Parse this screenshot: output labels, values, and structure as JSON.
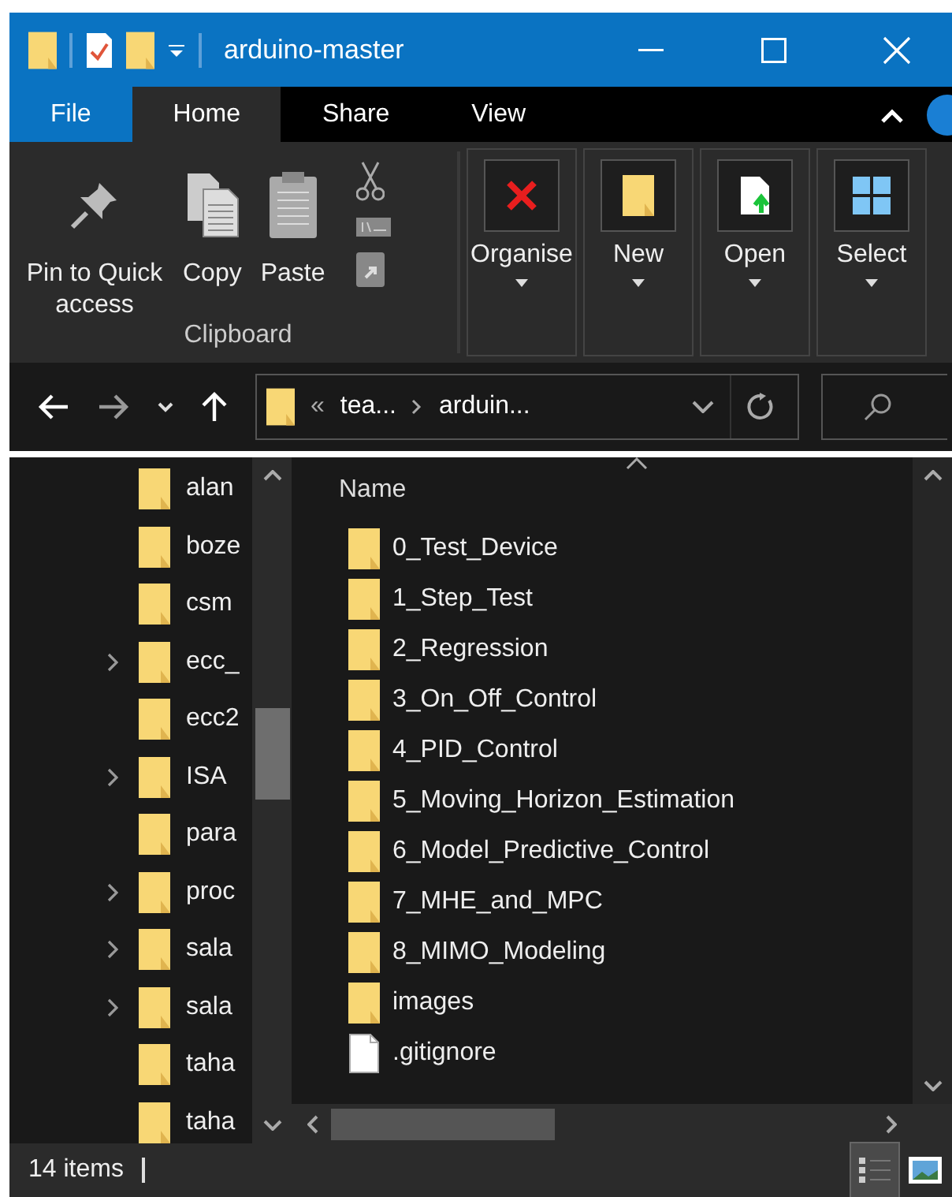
{
  "window": {
    "title": "arduino-master"
  },
  "tabs": [
    {
      "label": "File",
      "kind": "file",
      "selected": false
    },
    {
      "label": "Home",
      "kind": "tab",
      "selected": true
    },
    {
      "label": "Share",
      "kind": "tab",
      "selected": false
    },
    {
      "label": "View",
      "kind": "tab",
      "selected": false
    }
  ],
  "ribbon": {
    "clipboard": {
      "buttons": [
        {
          "label": "Pin to Quick access",
          "kind": "pin"
        },
        {
          "label": "Copy",
          "kind": "copy"
        },
        {
          "label": "Paste",
          "kind": "paste"
        }
      ],
      "group_label": "Clipboard"
    },
    "groups": [
      {
        "label": "Organise",
        "kind": "organise"
      },
      {
        "label": "New",
        "kind": "new"
      },
      {
        "label": "Open",
        "kind": "open"
      },
      {
        "label": "Select",
        "kind": "select"
      }
    ]
  },
  "address": {
    "overflow": "«",
    "crumbs": [
      "tea...",
      "arduin..."
    ]
  },
  "navigation": {
    "items": [
      {
        "label": "alan",
        "expandable": false
      },
      {
        "label": "boze",
        "expandable": false
      },
      {
        "label": "csm",
        "expandable": false
      },
      {
        "label": "ecc_",
        "expandable": true
      },
      {
        "label": "ecc2",
        "expandable": false
      },
      {
        "label": "ISA",
        "expandable": true
      },
      {
        "label": "para",
        "expandable": false
      },
      {
        "label": "proc",
        "expandable": true
      },
      {
        "label": "sala",
        "expandable": true
      },
      {
        "label": "sala",
        "expandable": true
      },
      {
        "label": "taha",
        "expandable": false
      },
      {
        "label": "taha",
        "expandable": false
      }
    ]
  },
  "files": {
    "column": "Name",
    "items": [
      {
        "name": "0_Test_Device",
        "kind": "folder"
      },
      {
        "name": "1_Step_Test",
        "kind": "folder"
      },
      {
        "name": "2_Regression",
        "kind": "folder"
      },
      {
        "name": "3_On_Off_Control",
        "kind": "folder"
      },
      {
        "name": "4_PID_Control",
        "kind": "folder"
      },
      {
        "name": "5_Moving_Horizon_Estimation",
        "kind": "folder"
      },
      {
        "name": "6_Model_Predictive_Control",
        "kind": "folder"
      },
      {
        "name": "7_MHE_and_MPC",
        "kind": "folder"
      },
      {
        "name": "8_MIMO_Modeling",
        "kind": "folder"
      },
      {
        "name": "images",
        "kind": "folder"
      },
      {
        "name": ".gitignore",
        "kind": "file"
      }
    ]
  },
  "status_bar": {
    "count": "14 items",
    "views": [
      {
        "kind": "details",
        "selected": true
      },
      {
        "kind": "large_icons",
        "selected": false
      }
    ]
  }
}
